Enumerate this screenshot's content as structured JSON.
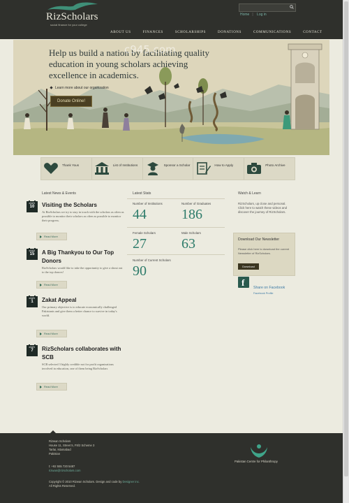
{
  "brand": {
    "name": "RizScholars",
    "tagline": "social finance for your college",
    "accent": "#2d7b6a",
    "dark": "#2f302c"
  },
  "header": {
    "search_placeholder": "",
    "top_links": [
      "Home",
      "Log in"
    ],
    "nav": [
      "ABOUT US",
      "FINANCES",
      "SCHOLARSHIPS",
      "DONATIONS",
      "COMMUNICATIONS",
      "CONTACT"
    ]
  },
  "hero": {
    "headline": "Help us build a nation by facilitating quality education in young scholars achieving excellence in academics.",
    "learn_more": "Learn more about our organization",
    "donate_label": "Donate Online!",
    "watermark": "c945.com"
  },
  "iconbar": [
    {
      "icon": "hands-heart-icon",
      "label": "Thank Yous"
    },
    {
      "icon": "institution-icon",
      "label": "List of Institutions"
    },
    {
      "icon": "graduate-icon",
      "label": "Sponsor a Scholar"
    },
    {
      "icon": "form-pen-icon",
      "label": "How to Apply"
    },
    {
      "icon": "camera-icon",
      "label": "Photo Archive"
    }
  ],
  "news": {
    "title": "Latest News & Events",
    "items": [
      {
        "month": "MAR",
        "day": "10",
        "title": "Visiting the Scholars",
        "body": "At RizScholars we try to stay in touch with the scholars as often as possible to monitor their scholars as often as possible to monitor their progress.",
        "readmore": "Read More"
      },
      {
        "month": "MAR",
        "day": "15",
        "title": "A Big Thankyou to Our Top Donors",
        "body": "RizScholars would like to take the opportunity to give a shout out to the top donors!",
        "readmore": "Read More"
      },
      {
        "month": "MAR",
        "day": "1",
        "title": "Zakat Appeal",
        "body": "Our primary objective is to educate economically challenged Pakistanis and give them a better chance to survive in today's world.",
        "readmore": "Read More"
      },
      {
        "month": "MAR",
        "day": "7",
        "title": "RizScholars collaborates with SCB",
        "body": "SCB selected 3 highly credible not for profit organizations involved in education, one of them being RizScholars",
        "readmore": "Read More"
      }
    ]
  },
  "stats": {
    "title": "Latest Stats",
    "items": [
      {
        "label": "Number of Institutions",
        "value": "44"
      },
      {
        "label": "Number of Graduates",
        "value": "186"
      },
      {
        "label": "Female Scholars",
        "value": "27"
      },
      {
        "label": "Male Scholars",
        "value": "63"
      },
      {
        "label": "Number of Current Scholars",
        "value": "90"
      }
    ]
  },
  "watch": {
    "title": "Watch & Learn",
    "body": "RizScholars, up close and personal. Click here to watch these videos and discover the journey of RizScholars."
  },
  "newsletter": {
    "title": "Download Our Newsletter",
    "body": "Please click here to download the current Newsletter of RizScholars.",
    "button": "Download"
  },
  "facebook": {
    "share": "Share on Facebook",
    "profile": "Facebook Profile"
  },
  "footer": {
    "address": [
      "Rizwan Scholars",
      "House 11, Street 5, F8/2 Scheme 3",
      "Tarlai, Islamabad",
      "Pakistan"
    ],
    "phone": "t: +92 555 720 5487",
    "email": "rizwan@rizscholars.com",
    "copyright": "Copyright © 2010 Rizwan Scholars. Design and code by",
    "designer": "Designer inc.",
    "rights": "All Rights Reserved.",
    "partner": "Pakistan Centre for Philanthropy"
  }
}
